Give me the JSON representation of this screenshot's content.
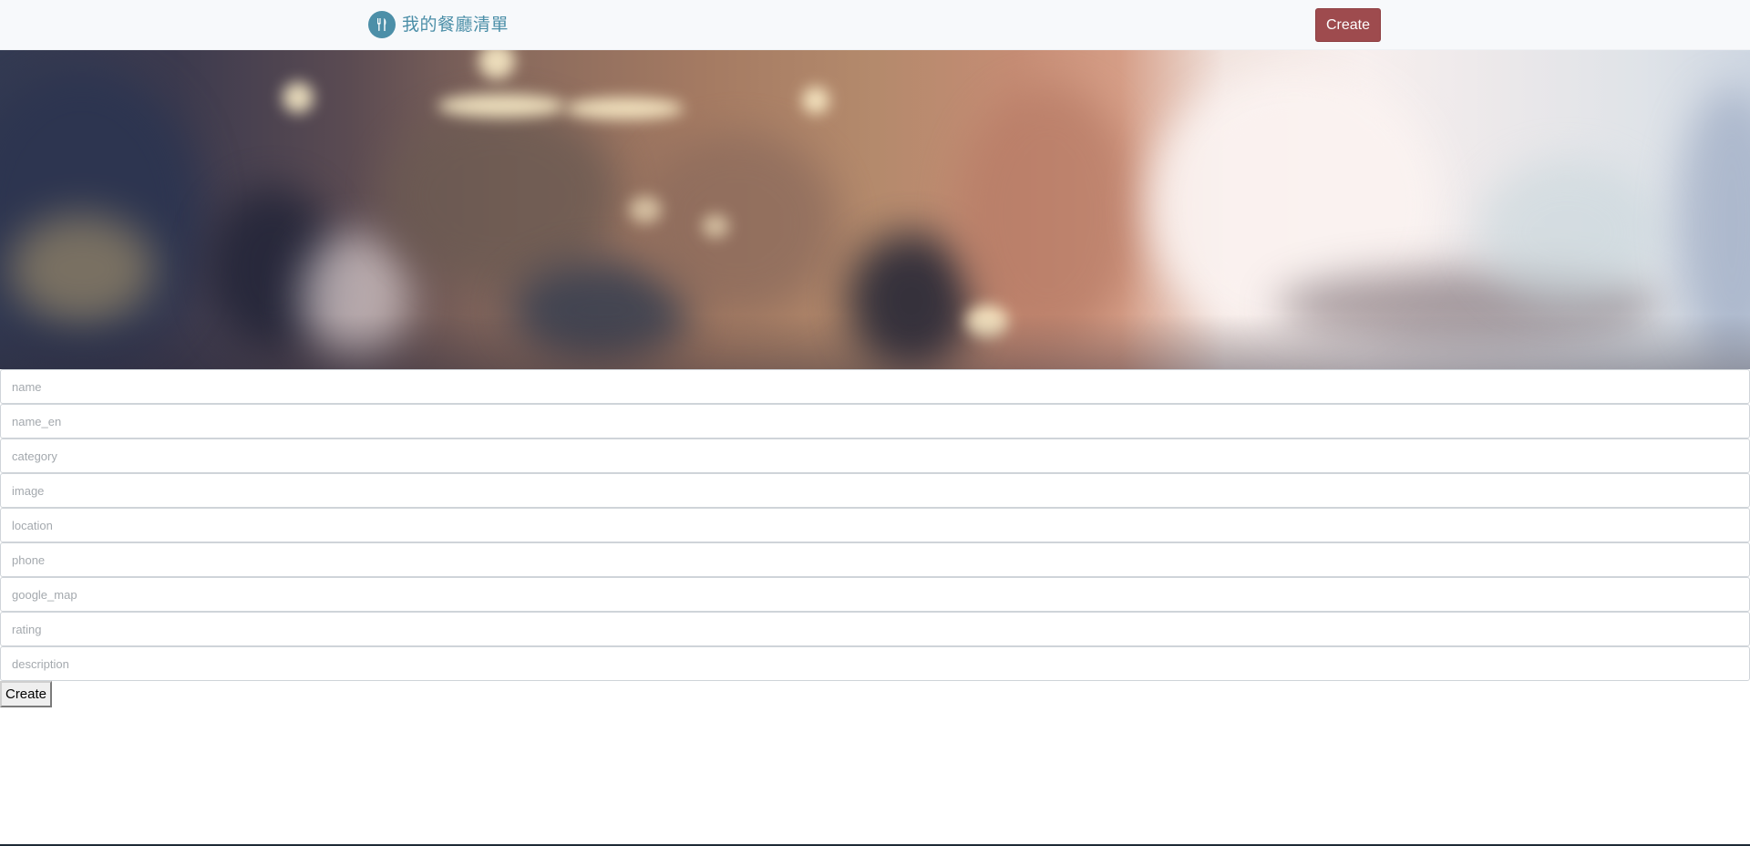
{
  "navbar": {
    "brand_title": "我的餐廳清單",
    "brand_icon": "utensils-icon",
    "create_label": "Create"
  },
  "hero": {
    "image": "blurred-restaurant-interior"
  },
  "form": {
    "fields": [
      {
        "placeholder": "name",
        "value": ""
      },
      {
        "placeholder": "name_en",
        "value": ""
      },
      {
        "placeholder": "category",
        "value": ""
      },
      {
        "placeholder": "image",
        "value": ""
      },
      {
        "placeholder": "location",
        "value": ""
      },
      {
        "placeholder": "phone",
        "value": ""
      },
      {
        "placeholder": "google_map",
        "value": ""
      },
      {
        "placeholder": "rating",
        "value": ""
      },
      {
        "placeholder": "description",
        "value": ""
      }
    ],
    "submit_label": "Create"
  },
  "colors": {
    "brand": "#4c8fa8",
    "create_button": "#9e4b4e",
    "navbar_bg": "#f7f9fb"
  }
}
